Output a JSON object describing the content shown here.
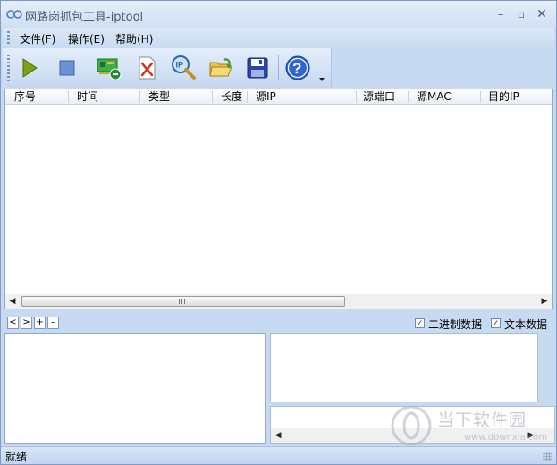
{
  "window": {
    "title": "网路岗抓包工具-iptool",
    "controls": {
      "minimize": "–",
      "maximize": "▫",
      "close": "✕"
    }
  },
  "menu": [
    {
      "label": "文件(F)"
    },
    {
      "label": "操作(E)"
    },
    {
      "label": "帮助(H)"
    }
  ],
  "toolbar": {
    "buttons": [
      {
        "icon": "play-icon",
        "color": "#7a9b1a"
      },
      {
        "icon": "stop-icon",
        "color": "#5d86cc"
      },
      {
        "icon": "network-card-icon",
        "color": "#3a9a3a"
      },
      {
        "icon": "delete-icon",
        "color": "#d23b2a"
      },
      {
        "icon": "ip-search-icon",
        "color": "#2b6fc4"
      },
      {
        "icon": "open-folder-icon",
        "color": "#e6b53a"
      },
      {
        "icon": "save-icon",
        "color": "#2a3fa8"
      },
      {
        "icon": "help-icon",
        "color": "#2c63c9"
      }
    ]
  },
  "packet_list": {
    "columns": [
      "序号",
      "时间",
      "类型",
      "长度",
      "源IP",
      "源端口",
      "源MAC",
      "目的IP"
    ],
    "rows": []
  },
  "navigation": {
    "buttons": [
      "<",
      ">",
      "+",
      "–"
    ],
    "options": [
      {
        "label": "二进制数据",
        "checked": true
      },
      {
        "label": "文本数据",
        "checked": true
      }
    ]
  },
  "watermark": {
    "name": "当下软件园",
    "url": "www.downxia.com"
  },
  "status": {
    "text": "就绪"
  }
}
